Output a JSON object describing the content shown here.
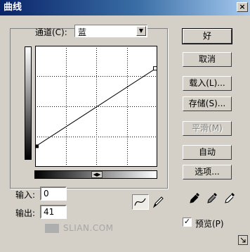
{
  "window": {
    "title": "曲线"
  },
  "channel": {
    "label": "通道(C):",
    "value": "蓝"
  },
  "input": {
    "label": "输入:",
    "value": "0"
  },
  "output": {
    "label": "输出:",
    "value": "41"
  },
  "buttons": {
    "ok": "好",
    "cancel": "取消",
    "load": "载入(L)...",
    "save": "存储(S)...",
    "smooth": "平滑(M)",
    "auto": "自动",
    "options": "选项..."
  },
  "preview": {
    "label": "预览(P)",
    "checked": true
  },
  "curve": {
    "points": [
      [
        0,
        41
      ],
      [
        255,
        208
      ]
    ],
    "range": [
      0,
      255
    ]
  },
  "icons": [
    "curve-tool-icon",
    "pencil-tool-icon",
    "black-eyedropper-icon",
    "gray-eyedropper-icon",
    "white-eyedropper-icon",
    "resize-grip-icon"
  ],
  "watermark": "SLIAN.COM"
}
